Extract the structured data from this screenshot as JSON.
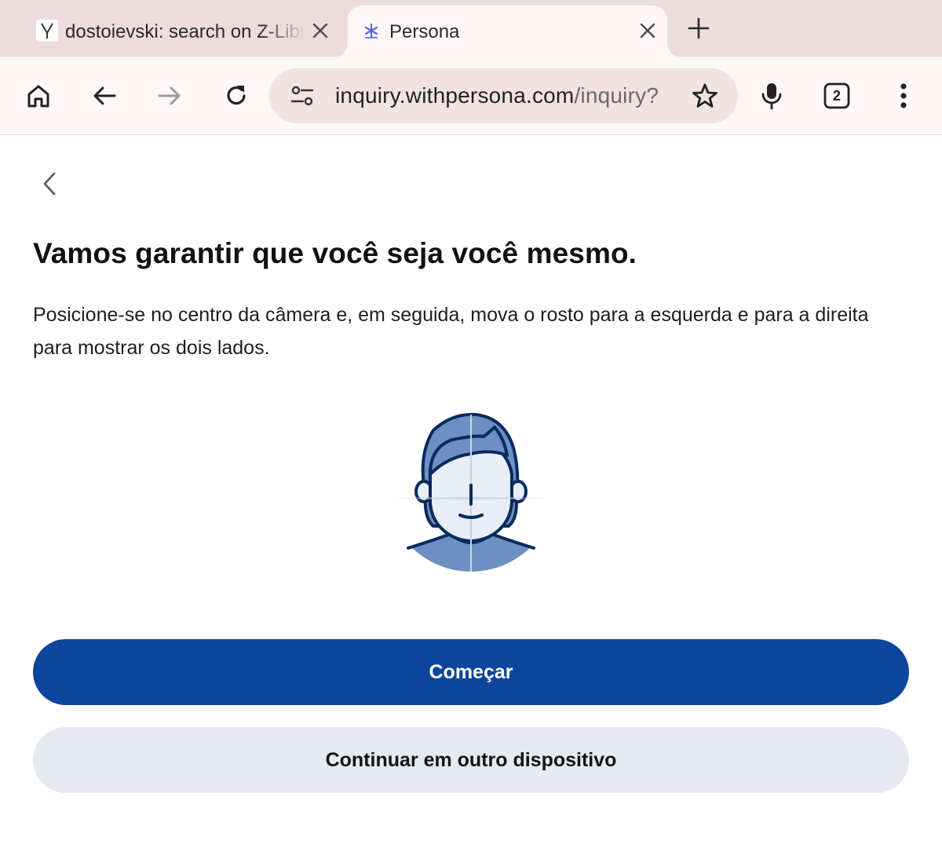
{
  "browser": {
    "tabs": [
      {
        "title": "dostoievski: search on Z-Library",
        "favicon": "z-library-icon",
        "active": false
      },
      {
        "title": "Persona",
        "favicon": "persona-asterisk-icon",
        "active": true
      }
    ],
    "address_bar": {
      "host": "inquiry.withpersona.com",
      "path": "/inquiry?",
      "tune_icon": "site-settings-icon",
      "bookmark_icon": "star-icon"
    },
    "toolbar_icons": [
      "home-icon",
      "back-arrow-icon",
      "forward-arrow-icon",
      "reload-icon",
      "microphone-icon",
      "tab-switcher-icon",
      "overflow-menu-icon"
    ],
    "tab_count": "2"
  },
  "page": {
    "heading": "Vamos garantir que você seja você mesmo.",
    "description": "Posicione-se no centro da câmera e, em seguida, mova o rosto para a esquerda e para a direita para mostrar os dois lados.",
    "primary_button": "Começar",
    "secondary_button": "Continuar em outro dispositivo"
  },
  "colors": {
    "primary_button": "#0c459c",
    "secondary_button": "#e6eaee",
    "tab_strip": "#eddcde",
    "toolbar": "#fdf7f7",
    "illustration_dark": "#0a2a5e",
    "illustration_hair": "#6d8fc2",
    "illustration_face": "#e8edf6"
  }
}
